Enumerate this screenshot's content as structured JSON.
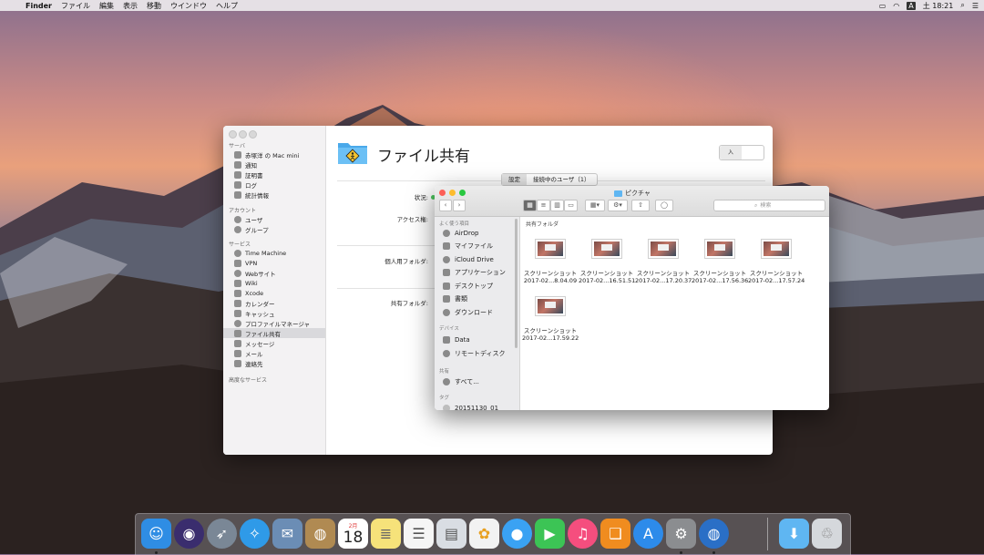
{
  "menubar": {
    "app": "Finder",
    "items": [
      "ファイル",
      "編集",
      "表示",
      "移動",
      "ウインドウ",
      "ヘルプ"
    ],
    "input_method": "A",
    "clock": "土 18:21"
  },
  "server_window": {
    "sidebar": {
      "sections": {
        "server": "サーバ",
        "accounts": "アカウント",
        "services": "サービス",
        "advanced": "高度なサービス"
      },
      "server_items": [
        "赤塚洋 の Mac mini",
        "通知",
        "証明書",
        "ログ",
        "統計情報"
      ],
      "account_items": [
        "ユーザ",
        "グループ"
      ],
      "service_items": [
        "Time Machine",
        "VPN",
        "Webサイト",
        "Wiki",
        "Xcode",
        "カレンダー",
        "キャッシュ",
        "プロファイルマネージャ",
        "ファイル共有",
        "メッセージ",
        "メール",
        "連絡先"
      ]
    },
    "title": "ファイル共有",
    "toggle_label": "入",
    "tabs": [
      "設定",
      "接続中のユーザ（1）"
    ],
    "labels": {
      "status": "状況:",
      "access": "アクセス権:",
      "personal_folder": "個人用フォルダ:",
      "shared_folder": "共有フォルダ:"
    }
  },
  "finder": {
    "title": "ピクチャ",
    "search_placeholder": "検索",
    "path_label": "共有フォルダ",
    "sidebar": {
      "favorites_header": "よく使う項目",
      "favorites": [
        "AirDrop",
        "マイファイル",
        "iCloud Drive",
        "アプリケーション",
        "デスクトップ",
        "書類",
        "ダウンロード"
      ],
      "devices_header": "デバイス",
      "devices": [
        "Data",
        "リモートディスク"
      ],
      "shared_header": "共有",
      "shared": [
        "すべて..."
      ],
      "tags_header": "タグ",
      "tags": [
        "20151130_01"
      ]
    },
    "files": [
      {
        "name": "スクリーンショット",
        "date": "2017-02...8.04.09"
      },
      {
        "name": "スクリーンショット",
        "date": "2017-02...16.51.51"
      },
      {
        "name": "スクリーンショット",
        "date": "2017-02...17.20.37"
      },
      {
        "name": "スクリーンショット",
        "date": "2017-02...17.56.36"
      },
      {
        "name": "スクリーンショット",
        "date": "2017-02...17.57.24"
      },
      {
        "name": "スクリーンショット",
        "date": "2017-02...17.59.22"
      }
    ]
  },
  "dock": {
    "calendar_month": "2月",
    "calendar_day": "18",
    "apps": [
      {
        "icon": "finder-icon",
        "color": "#2f8de4"
      },
      {
        "icon": "siri-icon",
        "color": "#3a2d6e"
      },
      {
        "icon": "launchpad-icon",
        "color": "#7a8796"
      },
      {
        "icon": "safari-icon",
        "color": "#2f9ae8"
      },
      {
        "icon": "mail-icon",
        "color": "#6b8db5"
      },
      {
        "icon": "contacts-icon",
        "color": "#b08a52"
      },
      {
        "icon": "calendar-icon",
        "color": "#ffffff"
      },
      {
        "icon": "notes-icon",
        "color": "#f6e27a"
      },
      {
        "icon": "reminders-icon",
        "color": "#f5f5f5"
      },
      {
        "icon": "preview-icon",
        "color": "#d9dde3"
      },
      {
        "icon": "photos-icon",
        "color": "#f2f2f2"
      },
      {
        "icon": "messages-icon",
        "color": "#3aa2f3"
      },
      {
        "icon": "facetime-icon",
        "color": "#3cc455"
      },
      {
        "icon": "itunes-icon",
        "color": "#f54e7e"
      },
      {
        "icon": "ibooks-icon",
        "color": "#f08c1f"
      },
      {
        "icon": "appstore-icon",
        "color": "#2d8bea"
      },
      {
        "icon": "system-preferences-icon",
        "color": "#8b8d90"
      },
      {
        "icon": "network-globe-icon",
        "color": "#2a6fc6"
      },
      {
        "icon": "downloads-folder-icon",
        "color": "#5fb6f2"
      },
      {
        "icon": "trash-icon",
        "color": "#d5d8dc"
      }
    ]
  }
}
